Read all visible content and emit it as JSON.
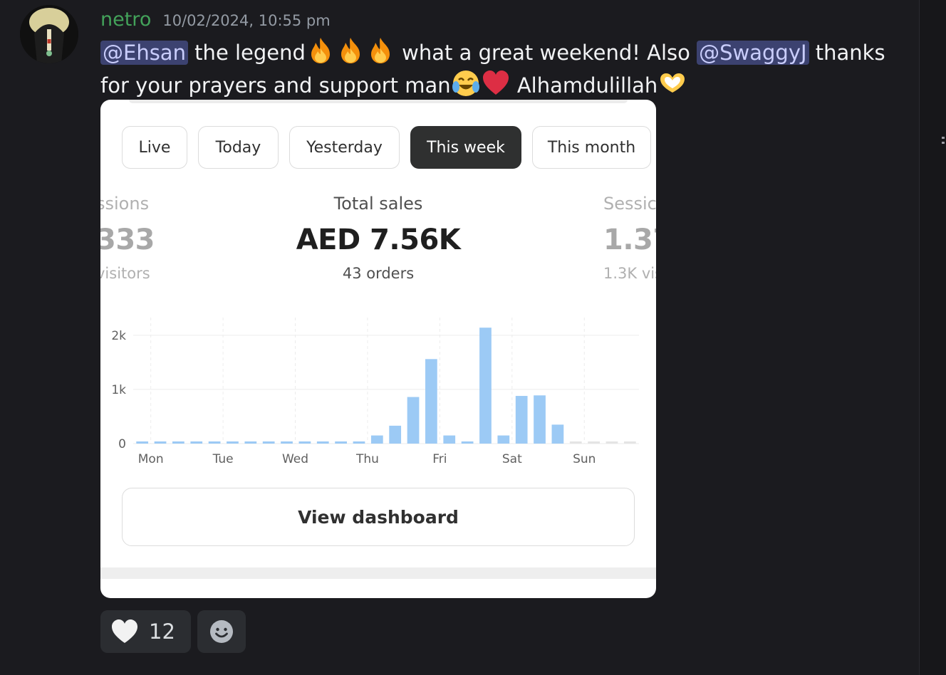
{
  "message": {
    "author": "netro",
    "timestamp": "10/02/2024, 10:55 pm",
    "mention_1": "@Ehsan",
    "text_1": " the legend",
    "text_2": " what a great weekend! Also ",
    "mention_2": "@SwaggyJ",
    "text_3": "  thanks for your prayers and support man",
    "text_4": " Alhamdulillah"
  },
  "emojis": [
    "fire-emoji",
    "fire-emoji",
    "fire-emoji",
    "joy-emoji",
    "red-heart-emoji",
    "heart-hands-emoji"
  ],
  "embed": {
    "tabs": [
      {
        "label": "Live",
        "active": false
      },
      {
        "label": "Today",
        "active": false
      },
      {
        "label": "Yesterday",
        "active": false
      },
      {
        "label": "This week",
        "active": true
      },
      {
        "label": "This month",
        "active": false
      }
    ],
    "metrics": {
      "left": {
        "label": "ssions",
        "value": "333",
        "sub": "visitors"
      },
      "center": {
        "label": "Total sales",
        "value": "AED 7.56K",
        "sub": "43 orders"
      },
      "right": {
        "label": "Sessic",
        "value": "1.37",
        "sub": "1.3K vis"
      }
    },
    "button_label": "View dashboard"
  },
  "chart_data": {
    "type": "bar",
    "x_labels": [
      "Mon",
      "Tue",
      "Wed",
      "Thu",
      "Fri",
      "Sat",
      "Sun"
    ],
    "y_ticks": [
      "0",
      "1k",
      "2k"
    ],
    "ylim": [
      0,
      2300
    ],
    "grid": true,
    "values": [
      40,
      40,
      40,
      40,
      40,
      40,
      40,
      40,
      40,
      40,
      40,
      40,
      40,
      150,
      330,
      860,
      1560,
      150,
      40,
      2140,
      150,
      880,
      890,
      350,
      10,
      10,
      10,
      10
    ],
    "bar_color": "#9ccaf5",
    "future_bar_color": "#e4e4e4",
    "future_from_index": 24
  },
  "reactions": [
    {
      "emoji": "white-heart-icon",
      "count": "12"
    }
  ],
  "colors": {
    "background": "#1b1b1f",
    "username": "#43a25a",
    "mention_bg": "#3c4270",
    "mention_text": "#c9cdfb",
    "active_tab": "#2f3030"
  }
}
